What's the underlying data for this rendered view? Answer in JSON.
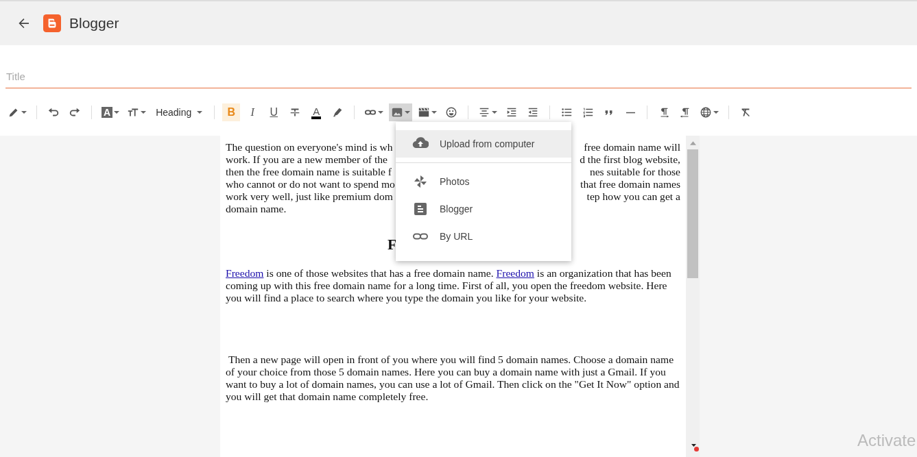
{
  "header": {
    "app_name": "Blogger"
  },
  "title_field": {
    "placeholder": "Title"
  },
  "toolbar": [
    {
      "kind": "icon",
      "dropdown": true,
      "selected": false
    },
    {
      "kind": "divider"
    },
    {
      "kind": "icon",
      "dropdown": false,
      "selected": false
    },
    {
      "kind": "icon",
      "dropdown": false,
      "selected": false
    },
    {
      "kind": "divider"
    },
    {
      "kind": "glyph",
      "glyph": "A",
      "dropdown": true,
      "selected": false
    },
    {
      "kind": "icon",
      "dropdown": true,
      "selected": false
    },
    {
      "kind": "label",
      "label": "Heading",
      "dropdown": true,
      "selected": false
    },
    {
      "kind": "divider"
    },
    {
      "kind": "glyph",
      "glyph": "B",
      "dropdown": false,
      "selected": true
    },
    {
      "kind": "glyph",
      "glyph": "I",
      "dropdown": false,
      "selected": false
    },
    {
      "kind": "glyph",
      "glyph": "U",
      "dropdown": false,
      "selected": false
    },
    {
      "kind": "icon",
      "dropdown": false,
      "selected": false
    },
    {
      "kind": "glyph",
      "glyph": "A",
      "color": "#000000",
      "dropdown": false,
      "selected": false
    },
    {
      "kind": "icon",
      "dropdown": false,
      "selected": false
    },
    {
      "kind": "divider"
    },
    {
      "kind": "icon",
      "dropdown": true,
      "selected": false
    },
    {
      "kind": "icon",
      "dropdown": true,
      "selected": true
    },
    {
      "kind": "icon",
      "dropdown": true,
      "selected": false
    },
    {
      "kind": "icon",
      "dropdown": false,
      "selected": false
    },
    {
      "kind": "divider"
    },
    {
      "kind": "icon",
      "dropdown": true,
      "selected": false
    },
    {
      "kind": "icon",
      "dropdown": false,
      "selected": false
    },
    {
      "kind": "icon",
      "dropdown": false,
      "selected": false
    },
    {
      "kind": "divider"
    },
    {
      "kind": "icon",
      "dropdown": false,
      "selected": false
    },
    {
      "kind": "icon",
      "dropdown": false,
      "selected": false
    },
    {
      "kind": "icon",
      "dropdown": false,
      "selected": false
    },
    {
      "kind": "icon",
      "dropdown": false,
      "selected": false
    },
    {
      "kind": "divider"
    },
    {
      "kind": "icon",
      "dropdown": false,
      "selected": false
    },
    {
      "kind": "icon",
      "dropdown": false,
      "selected": false
    },
    {
      "kind": "icon",
      "dropdown": true,
      "selected": false
    },
    {
      "kind": "divider"
    },
    {
      "kind": "icon",
      "dropdown": false,
      "selected": false
    }
  ],
  "image_menu": [
    {
      "label": "Upload from computer",
      "selected": true,
      "divider_after": true
    },
    {
      "label": "Photos",
      "selected": false,
      "divider_after": false
    },
    {
      "label": "Blogger",
      "selected": false,
      "divider_after": false
    },
    {
      "label": "By URL",
      "selected": false,
      "divider_after": false
    }
  ],
  "document": {
    "paragraph_1": [
      {
        "left": "The question on everyone's mind is wh",
        "right": "free domain name will"
      },
      {
        "left": "work. If you are a new member of the",
        "right": "d the first blog website,"
      },
      {
        "left": "then the free domain name is suitable f",
        "right": "nes suitable for those"
      },
      {
        "left": "who cannot or do not want to spend mo",
        "right": "that free domain names"
      },
      {
        "left": "work very well, just like premium dom",
        "right": "tep how you can get a"
      },
      {
        "left": "domain name."
      }
    ],
    "heading": "F",
    "paragraph_2": [
      {
        "text": "Freedom",
        "link": true
      },
      {
        "text": " is one of those websites that has a free domain name. ",
        "link": false
      },
      {
        "text": "Freedom",
        "link": true
      },
      {
        "text": " is an organization that has been coming up with this free domain name for a long time. First of all, you open the freedom website. Here you will find a place to search where you type the domain you like for your website.",
        "link": false
      }
    ],
    "paragraph_3": " Then a new page will open in front of you where you will find 5 domain names. Choose a domain name of your choice from those 5 domain names. Here you can buy a domain name with just a Gmail. If you want to buy a lot of domain names, you can use a lot of Gmail. Then click on the \"Get It Now\" option and you will get that domain name completely free."
  },
  "os_notice": "Activate"
}
